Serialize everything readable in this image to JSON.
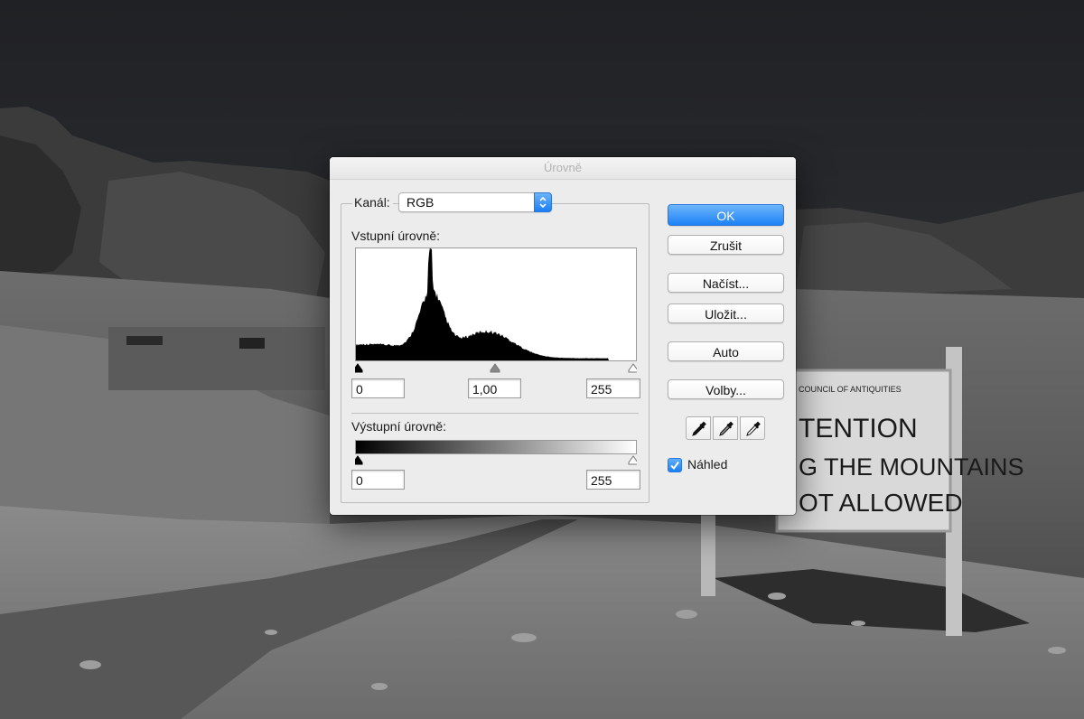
{
  "dialog": {
    "title": "Úrovně",
    "channel": {
      "label": "Kanál:",
      "value": "RGB"
    },
    "input": {
      "label": "Vstupní úrovně:",
      "black": "0",
      "gamma": "1,00",
      "white": "255"
    },
    "output": {
      "label": "Výstupní úrovně:",
      "black": "0",
      "white": "255"
    },
    "buttons": {
      "ok": "OK",
      "cancel": "Zrušit",
      "load": "Načíst...",
      "save": "Uložit...",
      "auto": "Auto",
      "options": "Volby..."
    },
    "preview": {
      "label": "Náhled",
      "checked": true
    }
  },
  "colors": {
    "accent": "#1d82f6",
    "dialog_bg": "#ececec"
  },
  "icons": {
    "channel_popup": "up-down-chevron-icon",
    "eyedroppers": [
      "black-eyedropper-icon",
      "gray-eyedropper-icon",
      "white-eyedropper-icon"
    ],
    "checkbox": "checkmark-icon"
  },
  "background_sign": {
    "line1": "COUNCIL OF ANTIQUITIES",
    "line2": "TENTION",
    "line3": "G THE MOUNTAINS",
    "line4": "OT ALLOWED"
  }
}
